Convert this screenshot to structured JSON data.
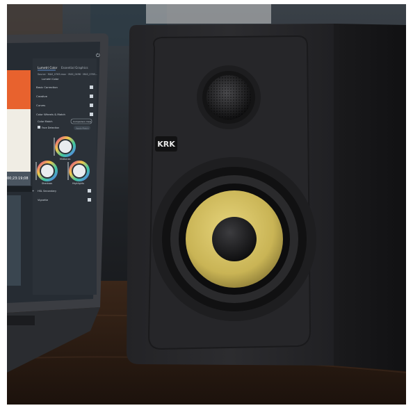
{
  "laptop": {
    "tabs": [
      "Lumetri Color",
      "Essential Graphics"
    ],
    "source_line": "Source · MAS_0765.mov  ·  MAS_0496 · MAS_0765...",
    "dropdown": "Lumetri Color",
    "sections": [
      "Basic Correction",
      "Creative",
      "Curves",
      "Color Wheels & Match"
    ],
    "color_match": "Color Match",
    "comparison_button": "Comparison View",
    "face_detection": "Face Detection",
    "apply_match": "Apply Match",
    "wheels": [
      "Midtones",
      "Shadows",
      "Highlights"
    ],
    "timecode": "00;23:19;08",
    "bottom_sections": [
      "HSL Secondary",
      "Vignette"
    ]
  },
  "speaker": {
    "brand": "KRK"
  },
  "colors": {
    "speaker_body": "#2a2a2d",
    "woofer_cone": "#d6c262",
    "table": "#2f1f16",
    "screen_bg": "#262c33"
  }
}
